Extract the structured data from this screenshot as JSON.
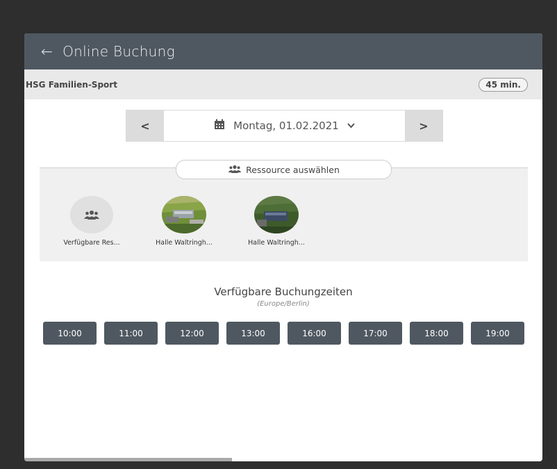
{
  "header": {
    "back_icon": "arrow-left-icon",
    "title": "Online Buchung"
  },
  "service": {
    "name": "HSG Familien-Sport",
    "duration": "45 min."
  },
  "date_nav": {
    "prev_label": "<",
    "next_label": ">",
    "date": "Montag, 01.02.2021",
    "calendar_icon": "calendar-icon",
    "chevron_icon": "chevron-down-icon"
  },
  "resource": {
    "button_label": "Ressource auswählen",
    "icon": "users-icon",
    "items": [
      {
        "label": "Verfügbare Res...",
        "type": "generic"
      },
      {
        "label": "Halle Waltringh...",
        "type": "photo"
      },
      {
        "label": "Halle Waltringh...",
        "type": "photo"
      }
    ]
  },
  "times": {
    "title": "Verfügbare Buchungzeiten",
    "timezone": "(Europe/Berlin)",
    "slots": [
      "10:00",
      "11:00",
      "12:00",
      "13:00",
      "16:00",
      "17:00",
      "18:00",
      "19:00"
    ]
  },
  "colors": {
    "header_bg": "#4f5861",
    "slot_bg": "#4f5861",
    "subbar_bg": "#e9e9e9"
  }
}
